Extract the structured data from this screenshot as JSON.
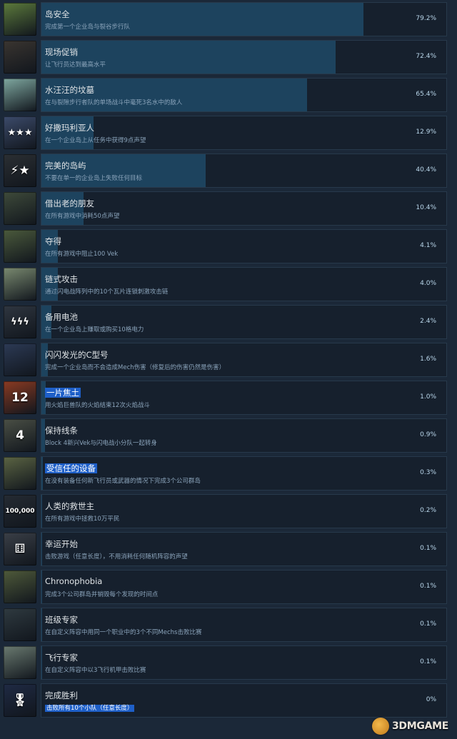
{
  "achievements": [
    {
      "title": "岛安全",
      "desc": "完成第一个企业岛与裂谷步行队",
      "percent": "79.2%",
      "fill": 0.792,
      "icon": "island-icon",
      "icon_color": "#5c7a3c",
      "glyph": ""
    },
    {
      "title": "现场促销",
      "desc": "让飞行员达到最高水平",
      "percent": "72.4%",
      "fill": 0.724,
      "icon": "pilot-portrait-icon",
      "icon_color": "#3a3530",
      "glyph": ""
    },
    {
      "title": "水汪汪的坟墓",
      "desc": "在与裂隙步行者队的单场战斗中毫死3名水中的敌人",
      "percent": "65.4%",
      "fill": 0.654,
      "icon": "ice-crystal-icon",
      "icon_color": "#7fa8a0",
      "glyph": ""
    },
    {
      "title": "好撒玛利亚人",
      "desc": "在一个企业岛上从任务中获得9点声望",
      "percent": "12.9%",
      "fill": 0.129,
      "icon": "stars-icon",
      "icon_color": "#3c4b6b",
      "glyph": "★★★"
    },
    {
      "title": "完美的岛屿",
      "desc": "不要在单一的企业岛上失败任何目标",
      "percent": "40.4%",
      "fill": 0.404,
      "icon": "reputation-icons-icon",
      "icon_color": "#2b2f33",
      "glyph": "⚡★"
    },
    {
      "title": "借出老的朋友",
      "desc": "在所有游戏中消耗50点声望",
      "percent": "10.4%",
      "fill": 0.104,
      "icon": "ceo-portrait-icon",
      "icon_color": "#3e4a3a",
      "glyph": ""
    },
    {
      "title": "夺得",
      "desc": "在所有游戏中阻止100 Vek",
      "percent": "4.1%",
      "fill": 0.041,
      "icon": "mech-squad-icon",
      "icon_color": "#4b5a3c",
      "glyph": ""
    },
    {
      "title": "链式攻击",
      "desc": "通过闪电战阵列中的10个瓦片连锁刺激攻击链",
      "percent": "4.0%",
      "fill": 0.04,
      "icon": "chain-attack-icon",
      "icon_color": "#7a8a70",
      "glyph": ""
    },
    {
      "title": "备用电池",
      "desc": "在一个企业岛上赚取或购买10格电力",
      "percent": "2.4%",
      "fill": 0.024,
      "icon": "battery-icon",
      "icon_color": "#2f3640",
      "glyph": "ϟϟϟ"
    },
    {
      "title": "闪闪发光的C型号",
      "desc": "完成一个企业岛而不会造成Mech伤害（修复后的伤害仍然是伤害）",
      "percent": "1.6%",
      "fill": 0.016,
      "icon": "mech-repair-icon",
      "icon_color": "#2c3a55",
      "glyph": ""
    },
    {
      "title": "一片焦土",
      "desc": "用火焰巨兽队的火焰结束12次火焰战斗",
      "percent": "1.0%",
      "fill": 0.01,
      "icon": "scorched-earth-icon",
      "icon_color": "#8a3a22",
      "glyph": "12"
    },
    {
      "title": "保持线条",
      "desc": "Block 4新兴Vek与闪电战小分队一起转身",
      "percent": "0.9%",
      "fill": 0.009,
      "icon": "hold-line-icon",
      "icon_color": "#4a4f45",
      "glyph": "4"
    },
    {
      "title": "受信任的设备",
      "desc": "在没有装备任何新飞行员或武器的情况下完成3个公司群岛",
      "percent": "0.3%",
      "fill": 0.003,
      "icon": "cannon-icon",
      "icon_color": "#5b6443",
      "glyph": ""
    },
    {
      "title": "人类的救世主",
      "desc": "在所有游戏中拯救10万平民",
      "percent": "0.2%",
      "fill": 0.002,
      "icon": "civilians-icon",
      "icon_color": "#252b33",
      "glyph": "100,000"
    },
    {
      "title": "幸运开始",
      "desc": "击败游戏（任意长度），不用消耗任何随机阵容的声望",
      "percent": "0.1%",
      "fill": 0.001,
      "icon": "dice-icon",
      "icon_color": "#3a3f47",
      "glyph": "⚅"
    },
    {
      "title": "Chronophobia",
      "desc": "完成3个公司群岛并销毁每个发现的时间点",
      "percent": "0.1%",
      "fill": 0.001,
      "icon": "time-pod-icon",
      "icon_color": "#4f5a3a",
      "glyph": ""
    },
    {
      "title": "班级专家",
      "desc": "在自定义阵容中用同一个职业中的3个不同Mechs击败比赛",
      "percent": "0.1%",
      "fill": 0.001,
      "icon": "class-mechs-icon",
      "icon_color": "#2f3a40",
      "glyph": ""
    },
    {
      "title": "飞行专家",
      "desc": "在自定义阵容中以3飞行机甲击败比赛",
      "percent": "0.1%",
      "fill": 0.001,
      "icon": "flying-mechs-icon",
      "icon_color": "#6a7a70",
      "glyph": ""
    },
    {
      "title": "完成胜利",
      "desc": "击败所有10个小队（任意长度）",
      "percent": "0%",
      "fill": 0.0,
      "icon": "medal-icon",
      "icon_color": "#1f2a44",
      "glyph": "🎖"
    }
  ],
  "selected_titles": [
    10,
    12
  ],
  "selected_descs": [
    18
  ],
  "watermark": {
    "text": "3DMGAME"
  }
}
